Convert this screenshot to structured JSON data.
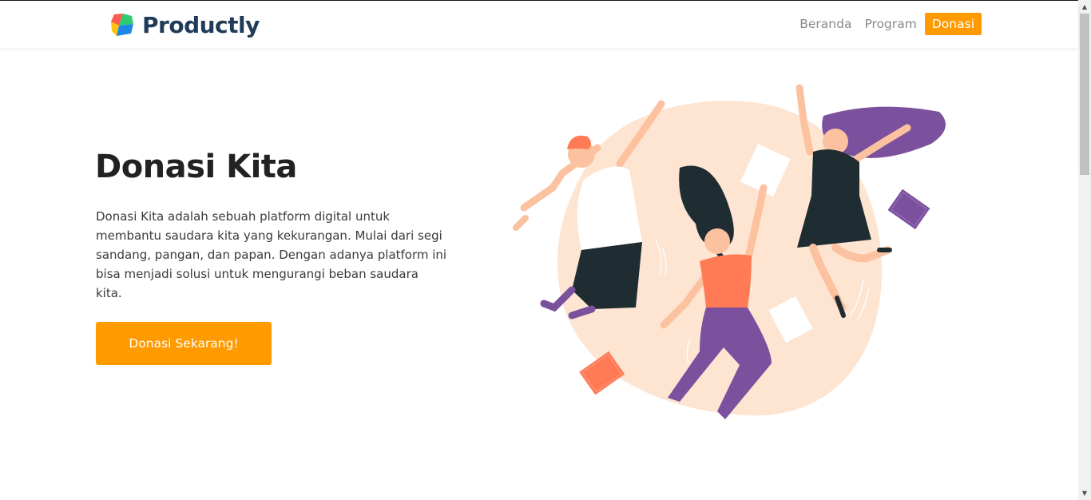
{
  "header": {
    "brand": "Productly",
    "nav": [
      {
        "label": "Beranda",
        "active": false
      },
      {
        "label": "Program",
        "active": false
      },
      {
        "label": "Donasi",
        "active": true
      }
    ]
  },
  "hero": {
    "title": "Donasi Kita",
    "description": "Donasi Kita adalah sebuah platform digital untuk membantu saudara kita yang kekurangan. Mulai dari segi sandang, pangan, dan papan. Dengan adanya platform ini bisa menjadi solusi untuk mengurangi beban saudara kita.",
    "cta_label": "Donasi Sekarang!"
  },
  "colors": {
    "accent": "#ff9a00",
    "brand_text": "#1f3b57",
    "blob": "#fde5d2",
    "purple": "#7b519d",
    "coral": "#ff7a55",
    "dark": "#1f2d33"
  },
  "icons": {
    "logo": "productly-logo-icon",
    "scroll_up": "arrow-up-icon",
    "scroll_down": "arrow-down-icon"
  }
}
